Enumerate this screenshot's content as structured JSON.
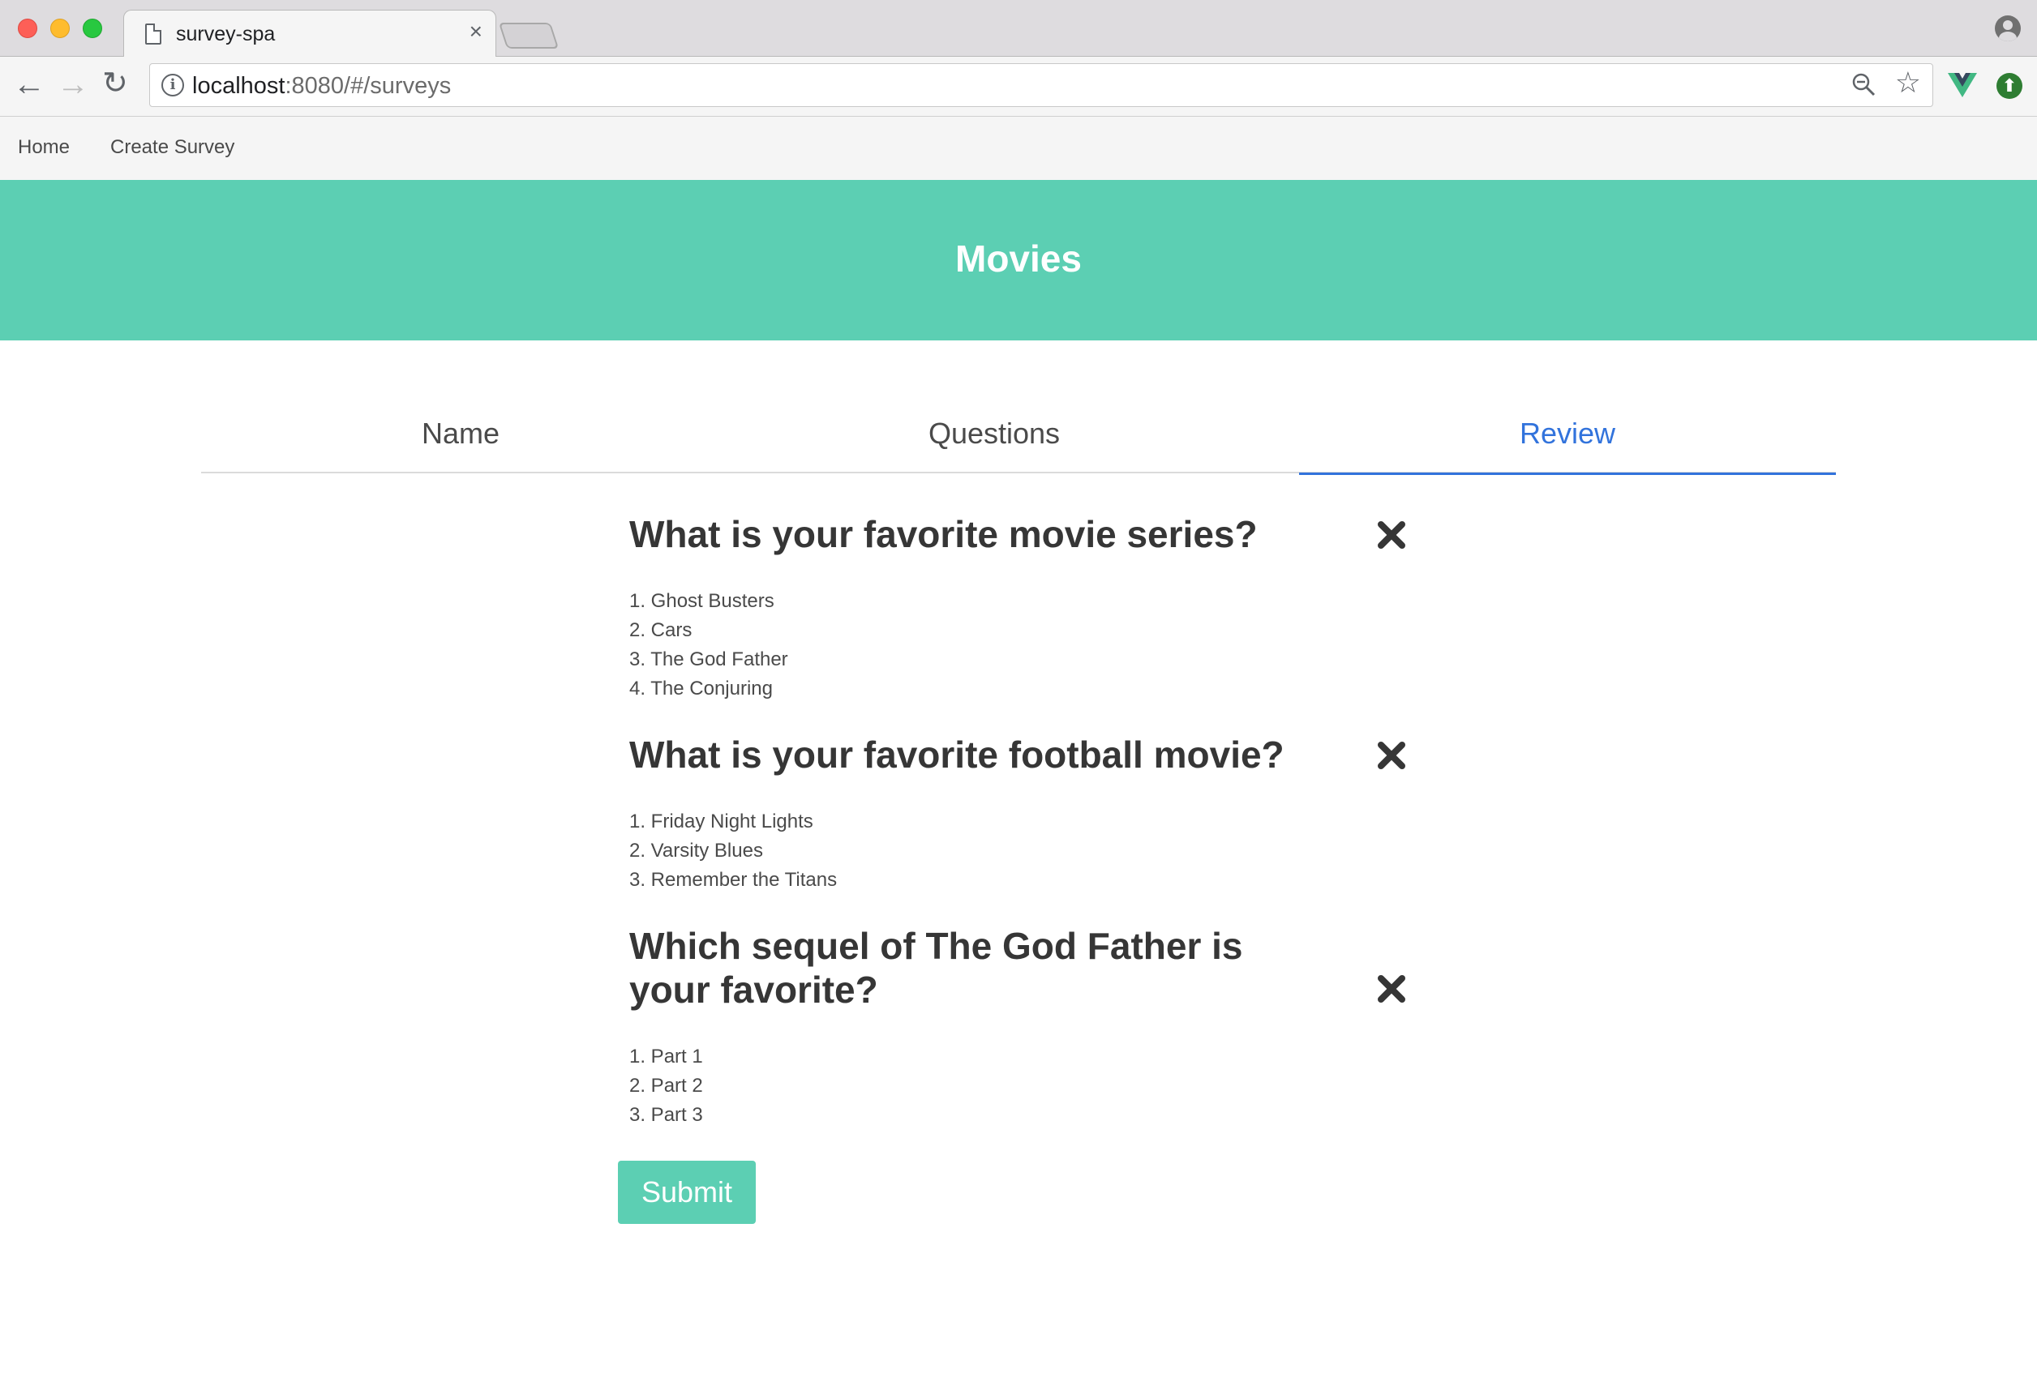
{
  "browser": {
    "tab_title": "survey-spa",
    "tab_close": "×",
    "url_host": "localhost",
    "url_rest": ":8080/#/surveys",
    "info_glyph": "i",
    "back_glyph": "←",
    "forward_glyph": "→",
    "reload_glyph": "↻",
    "star_glyph": "☆",
    "ext_glyph": "⬆"
  },
  "nav": {
    "home": "Home",
    "create_survey": "Create Survey"
  },
  "hero": {
    "title": "Movies"
  },
  "steps": [
    {
      "label": "Name",
      "active": false
    },
    {
      "label": "Questions",
      "active": false
    },
    {
      "label": "Review",
      "active": true
    }
  ],
  "questions": [
    {
      "text": "What is your favorite movie series?",
      "choices": [
        "1. Ghost Busters",
        "2. Cars",
        "3. The God Father",
        "4. The Conjuring"
      ]
    },
    {
      "text": "What is your favorite football movie?",
      "choices": [
        "1. Friday Night Lights",
        "2. Varsity Blues",
        "3. Remember the Titans"
      ]
    },
    {
      "text": "Which sequel of The God Father is your favorite?",
      "choices": [
        "1. Part 1",
        "2. Part 2",
        "3. Part 3"
      ]
    }
  ],
  "submit_label": "Submit",
  "colors": {
    "primary": "#5ccfb3",
    "link_active": "#3273dc",
    "heading": "#363636"
  },
  "icons": {
    "delete": "x-mark-icon",
    "tab_page": "page-icon",
    "zoom": "magnifier-icon",
    "vue": "vue-devtools-icon",
    "profile": "account-icon"
  }
}
